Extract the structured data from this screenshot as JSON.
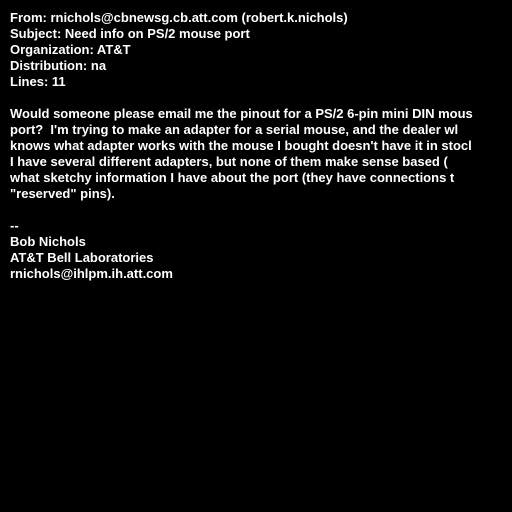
{
  "headers": {
    "from": "From: rnichols@cbnewsg.cb.att.com (robert.k.nichols)",
    "subject": "Subject: Need info on PS/2 mouse port",
    "organization": "Organization: AT&T",
    "distribution": "Distribution: na",
    "lines": "Lines: 11"
  },
  "body_lines": [
    "Would someone please email me the pinout for a PS/2 6-pin mini DIN mous",
    "port?  I'm trying to make an adapter for a serial mouse, and the dealer wl",
    "knows what adapter works with the mouse I bought doesn't have it in stocl",
    "I have several different adapters, but none of them make sense based (",
    "what sketchy information I have about the port (they have connections t",
    "\"reserved\" pins)."
  ],
  "signature": {
    "separator": "--",
    "name": "Bob Nichols",
    "organization": "AT&T Bell Laboratories",
    "email": "rnichols@ihlpm.ih.att.com"
  },
  "colors": {
    "background": "#000000",
    "text": "#ffffff"
  }
}
